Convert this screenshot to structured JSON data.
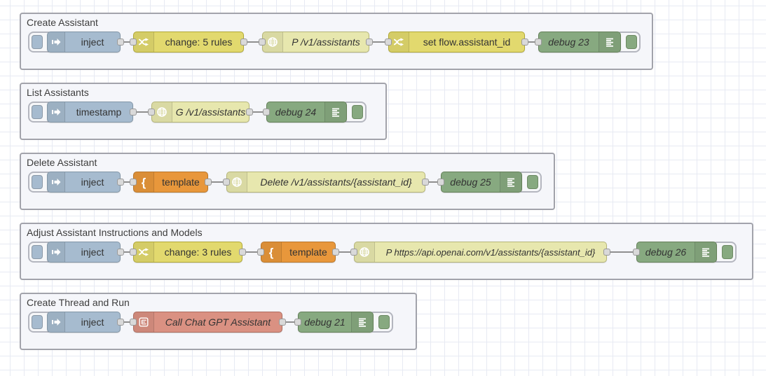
{
  "palette": {
    "canvas_bg": "#ffffff",
    "grid_line": "#e7eaf3",
    "group_fill": "#f5f6fa",
    "group_border": "#a2a3ab",
    "node_inject": "#a6bbcf",
    "node_change": "#e2d96e",
    "node_http_request": "#e7e7ae",
    "node_template": "#e8973b",
    "node_debug": "#87a980",
    "node_subflow": "#da9182",
    "wire": "#8f8f8f",
    "port": "#d9d9d9",
    "label_text": "#333333"
  },
  "icons": {
    "inject": "arrow-right-icon",
    "change": "shuffle-icon",
    "http_request": "globe-icon",
    "template": "curly-brace-icon",
    "debug": "list-lines-icon",
    "subflow": "subflow-box-icon"
  },
  "groups": [
    {
      "title": "Create Assistant",
      "nodes": [
        {
          "type": "inject",
          "label": "inject"
        },
        {
          "type": "change",
          "label": "change: 5 rules"
        },
        {
          "type": "http request",
          "label": "P /v1/assistants"
        },
        {
          "type": "change",
          "label": "set flow.assistant_id"
        },
        {
          "type": "debug",
          "label": "debug 23"
        }
      ]
    },
    {
      "title": "List Assistants",
      "nodes": [
        {
          "type": "inject",
          "label": "timestamp"
        },
        {
          "type": "http request",
          "label": "G /v1/assistants"
        },
        {
          "type": "debug",
          "label": "debug 24"
        }
      ]
    },
    {
      "title": "Delete Assistant",
      "nodes": [
        {
          "type": "inject",
          "label": "inject"
        },
        {
          "type": "template",
          "label": "template"
        },
        {
          "type": "http request",
          "label": "Delete /v1/assistants/{assistant_id}"
        },
        {
          "type": "debug",
          "label": "debug 25"
        }
      ]
    },
    {
      "title": "Adjust Assistant Instructions and Models",
      "nodes": [
        {
          "type": "inject",
          "label": "inject"
        },
        {
          "type": "change",
          "label": "change: 3 rules"
        },
        {
          "type": "template",
          "label": "template"
        },
        {
          "type": "http request",
          "label": "P https://api.openai.com/v1/assistants/{assistant_id}"
        },
        {
          "type": "debug",
          "label": "debug 26"
        }
      ]
    },
    {
      "title": "Create Thread and Run",
      "nodes": [
        {
          "type": "inject",
          "label": "inject"
        },
        {
          "type": "subflow",
          "label": "Call Chat GPT Assistant"
        },
        {
          "type": "debug",
          "label": "debug 21"
        }
      ]
    }
  ]
}
